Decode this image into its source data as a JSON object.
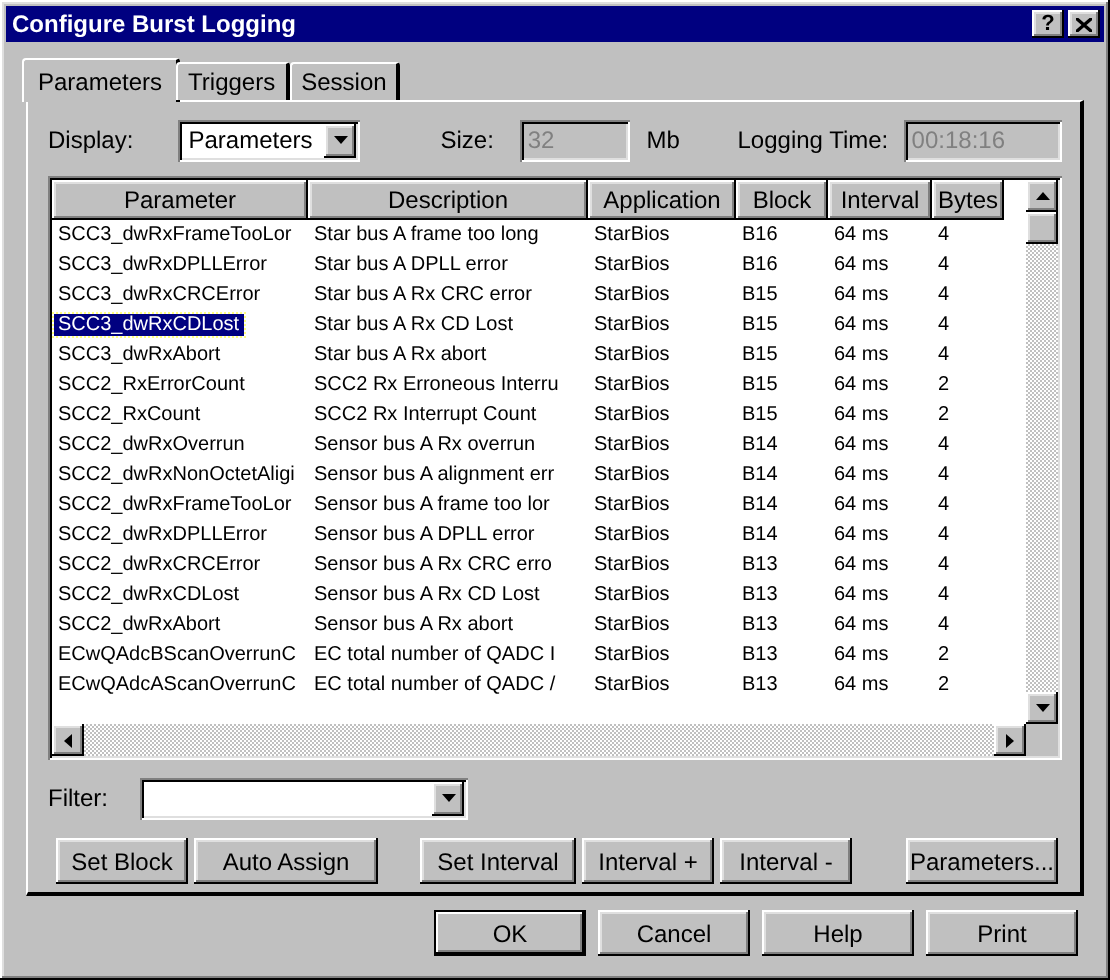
{
  "window": {
    "title": "Configure Burst Logging",
    "help_button": "?"
  },
  "tabs": [
    {
      "label": "Parameters",
      "selected": true
    },
    {
      "label": "Triggers",
      "selected": false
    },
    {
      "label": "Session",
      "selected": false
    }
  ],
  "display": {
    "label": "Display:",
    "value": "Parameters"
  },
  "size": {
    "label": "Size:",
    "value": "32",
    "unit": "Mb",
    "disabled": true
  },
  "logging_time": {
    "label": "Logging Time:",
    "value": "00:18:16",
    "disabled": true
  },
  "table": {
    "columns": [
      "Parameter",
      "Description",
      "Application",
      "Block",
      "Interval",
      "Bytes"
    ],
    "rows": [
      {
        "cells": [
          "SCC3_dwRxFrameTooLor",
          "Star bus A frame too long",
          "StarBios",
          "B16",
          "64 ms",
          "4"
        ],
        "selected": false
      },
      {
        "cells": [
          "SCC3_dwRxDPLLError",
          "Star bus A DPLL error",
          "StarBios",
          "B16",
          "64 ms",
          "4"
        ],
        "selected": false
      },
      {
        "cells": [
          "SCC3_dwRxCRCError",
          "Star bus A Rx CRC error",
          "StarBios",
          "B15",
          "64 ms",
          "4"
        ],
        "selected": false
      },
      {
        "cells": [
          "SCC3_dwRxCDLost",
          "Star bus A Rx CD Lost",
          "StarBios",
          "B15",
          "64 ms",
          "4"
        ],
        "selected": true
      },
      {
        "cells": [
          "SCC3_dwRxAbort",
          "Star bus A Rx abort",
          "StarBios",
          "B15",
          "64 ms",
          "4"
        ],
        "selected": false
      },
      {
        "cells": [
          "SCC2_RxErrorCount",
          "SCC2 Rx Erroneous Interru",
          "StarBios",
          "B15",
          "64 ms",
          "2"
        ],
        "selected": false
      },
      {
        "cells": [
          "SCC2_RxCount",
          "SCC2 Rx Interrupt Count",
          "StarBios",
          "B15",
          "64 ms",
          "2"
        ],
        "selected": false
      },
      {
        "cells": [
          "SCC2_dwRxOverrun",
          "Sensor bus A Rx overrun",
          "StarBios",
          "B14",
          "64 ms",
          "4"
        ],
        "selected": false
      },
      {
        "cells": [
          "SCC2_dwRxNonOctetAligi",
          "Sensor bus A alignment err",
          "StarBios",
          "B14",
          "64 ms",
          "4"
        ],
        "selected": false
      },
      {
        "cells": [
          "SCC2_dwRxFrameTooLor",
          "Sensor bus A frame too lor",
          "StarBios",
          "B14",
          "64 ms",
          "4"
        ],
        "selected": false
      },
      {
        "cells": [
          "SCC2_dwRxDPLLError",
          "Sensor bus A DPLL error",
          "StarBios",
          "B14",
          "64 ms",
          "4"
        ],
        "selected": false
      },
      {
        "cells": [
          "SCC2_dwRxCRCError",
          "Sensor bus A Rx CRC erro",
          "StarBios",
          "B13",
          "64 ms",
          "4"
        ],
        "selected": false
      },
      {
        "cells": [
          "SCC2_dwRxCDLost",
          "Sensor bus A Rx CD Lost",
          "StarBios",
          "B13",
          "64 ms",
          "4"
        ],
        "selected": false
      },
      {
        "cells": [
          "SCC2_dwRxAbort",
          "Sensor bus A Rx abort",
          "StarBios",
          "B13",
          "64 ms",
          "4"
        ],
        "selected": false
      },
      {
        "cells": [
          "ECwQAdcBScanOverrunC",
          "EC total number of QADC I",
          "StarBios",
          "B13",
          "64 ms",
          "2"
        ],
        "selected": false
      },
      {
        "cells": [
          "ECwQAdcAScanOverrunC",
          "EC total number of QADC /",
          "StarBios",
          "B13",
          "64 ms",
          "2"
        ],
        "selected": false
      }
    ]
  },
  "filter": {
    "label": "Filter:"
  },
  "action_buttons": [
    "Set Block",
    "Auto Assign",
    "Set Interval",
    "Interval +",
    "Interval -",
    "Parameters..."
  ],
  "dialog_buttons": [
    {
      "label": "OK",
      "default": true
    },
    {
      "label": "Cancel",
      "default": false
    },
    {
      "label": "Help",
      "default": false
    },
    {
      "label": "Print",
      "default": false
    }
  ]
}
